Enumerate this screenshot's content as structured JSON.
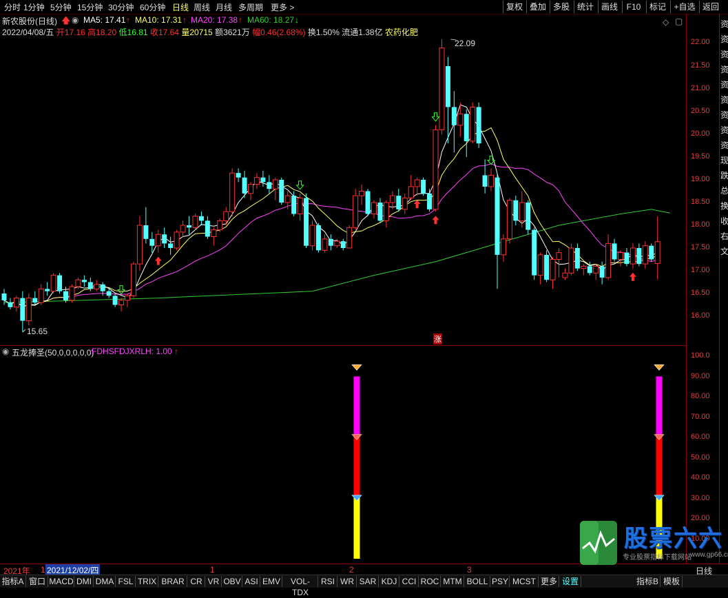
{
  "toolbar": {
    "periods": [
      "分时",
      "1分钟",
      "5分钟",
      "15分钟",
      "30分钟",
      "60分钟",
      "日线",
      "周线",
      "月线",
      "多周期",
      "更多 >"
    ],
    "active_period": "日线",
    "right_buttons": [
      "复权",
      "叠加",
      "多股",
      "统计",
      "画线",
      "F10",
      "标记",
      "+自选",
      "返回"
    ]
  },
  "header": {
    "stock": "新农股份(日线)",
    "ma5": "MA5: 17.41",
    "ma10": "MA10: 17.31",
    "ma20": "MA20: 17.38",
    "ma60": "MA60: 18.27",
    "date": "2022/04/08/五",
    "open_label": "开",
    "open": "17.16",
    "high_label": "高",
    "high": "18.20",
    "low_label": "低",
    "low": "16.81",
    "close_label": "收",
    "close": "17.64",
    "vol_label": "量",
    "vol": "20715",
    "amt_label": "额",
    "amt": "3621万",
    "chg_label": "幅",
    "chg": "0.46(2.68%)",
    "turnover": "换1.50%",
    "float": "流通1.38亿",
    "sector": "农药化肥"
  },
  "colors": {
    "up": "#ff3030",
    "down": "#54ffff",
    "ma5": "#ffffff",
    "ma10": "#ffff66",
    "ma20": "#ff44ff",
    "ma60": "#33cc33",
    "grid_red": "#8a0000"
  },
  "price_axis": [
    "22.00",
    "21.50",
    "21.00",
    "20.50",
    "20.00",
    "19.50",
    "19.00",
    "18.50",
    "18.00",
    "17.50",
    "17.00",
    "16.50",
    "16.00"
  ],
  "annotations": {
    "high_mark": "22.09",
    "low_mark": "15.65",
    "zhang": "涨"
  },
  "indicator": {
    "name": "五龙捧圣(50,0,0,0,0,0)",
    "value": "FDHSFDJXRLH: 1.00",
    "axis": [
      "100.0",
      "90.00",
      "80.00",
      "70.00",
      "60.00",
      "50.00",
      "40.00",
      "30.00",
      "20.00",
      "10.00"
    ]
  },
  "datebar": {
    "year": "2021年",
    "selected_date": "2021/12/02/四",
    "marks": [
      "1",
      "1",
      "2",
      "3"
    ]
  },
  "tabs": [
    "指标A",
    "窗口",
    "MACD",
    "DMI",
    "DMA",
    "FSL",
    "TRIX",
    "BRAR",
    "CR",
    "VR",
    "OBV",
    "ASI",
    "EMV",
    "VOL-TDX",
    "RSI",
    "WR",
    "SAR",
    "KDJ",
    "CCI",
    "ROC",
    "MTM",
    "BOLL",
    "PSY",
    "MCST",
    "更多",
    "设置"
  ],
  "tabs_right": [
    "指标B",
    "模板"
  ],
  "right_side_period": "日线",
  "side_text": [
    "资",
    "资",
    "资",
    "资",
    "资",
    "资",
    "资",
    "资",
    "资",
    "现",
    "跌",
    "总",
    "换",
    "收",
    "右",
    "文"
  ],
  "watermark": {
    "title": "股票六六",
    "subtitle": "专业股票指标下载网站",
    "url": "www.gp66.cn"
  },
  "chart_data": {
    "type": "candlestick",
    "candles": [
      [
        16.5,
        16.6,
        16.25,
        16.35
      ],
      [
        16.3,
        16.4,
        16.15,
        16.2
      ],
      [
        16.2,
        16.45,
        16.1,
        16.4
      ],
      [
        16.4,
        16.55,
        15.65,
        15.9
      ],
      [
        15.9,
        16.5,
        15.8,
        16.4
      ],
      [
        16.4,
        16.55,
        16.25,
        16.3
      ],
      [
        16.3,
        16.7,
        16.25,
        16.6
      ],
      [
        16.6,
        16.75,
        16.45,
        16.55
      ],
      [
        16.55,
        16.95,
        16.5,
        16.9
      ],
      [
        16.9,
        16.95,
        16.5,
        16.55
      ],
      [
        16.55,
        16.65,
        16.3,
        16.35
      ],
      [
        16.35,
        16.7,
        16.3,
        16.65
      ],
      [
        16.65,
        16.85,
        16.6,
        16.8
      ],
      [
        16.8,
        16.9,
        16.65,
        16.75
      ],
      [
        16.75,
        16.85,
        16.55,
        16.6
      ],
      [
        16.6,
        16.8,
        16.55,
        16.7
      ],
      [
        16.7,
        16.75,
        16.45,
        16.55
      ],
      [
        16.55,
        16.6,
        16.4,
        16.45
      ],
      [
        16.45,
        16.5,
        16.2,
        16.25
      ],
      [
        16.25,
        16.4,
        16.1,
        16.35
      ],
      [
        16.35,
        16.5,
        16.2,
        16.45
      ],
      [
        16.45,
        17.2,
        16.4,
        17.15
      ],
      [
        17.15,
        18.2,
        17.0,
        18.0
      ],
      [
        18.0,
        18.4,
        17.6,
        17.7
      ],
      [
        17.7,
        17.85,
        17.4,
        17.55
      ],
      [
        17.55,
        17.9,
        17.4,
        17.8
      ],
      [
        17.8,
        17.95,
        17.5,
        17.6
      ],
      [
        17.6,
        17.75,
        17.35,
        17.5
      ],
      [
        17.5,
        17.9,
        17.45,
        17.85
      ],
      [
        17.85,
        18.1,
        17.75,
        18.0
      ],
      [
        18.0,
        18.2,
        17.8,
        17.95
      ],
      [
        17.95,
        18.25,
        17.9,
        18.2
      ],
      [
        18.2,
        18.3,
        18.0,
        18.1
      ],
      [
        18.1,
        18.2,
        17.7,
        17.75
      ],
      [
        17.75,
        17.95,
        17.55,
        17.9
      ],
      [
        17.9,
        18.15,
        17.85,
        18.1
      ],
      [
        18.1,
        18.4,
        18.0,
        18.3
      ],
      [
        18.3,
        19.25,
        18.2,
        19.15
      ],
      [
        19.15,
        19.25,
        18.95,
        19.05
      ],
      [
        19.05,
        19.2,
        18.6,
        18.7
      ],
      [
        18.7,
        18.95,
        18.55,
        18.9
      ],
      [
        18.9,
        19.15,
        18.8,
        19.05
      ],
      [
        19.05,
        19.2,
        18.85,
        18.95
      ],
      [
        18.95,
        19.1,
        18.7,
        18.8
      ],
      [
        18.8,
        19.05,
        18.55,
        19.0
      ],
      [
        19.0,
        19.05,
        18.45,
        18.5
      ],
      [
        18.5,
        18.75,
        18.35,
        18.65
      ],
      [
        18.65,
        18.75,
        18.2,
        18.25
      ],
      [
        18.25,
        18.7,
        18.1,
        18.6
      ],
      [
        18.6,
        18.7,
        17.5,
        17.55
      ],
      [
        17.55,
        18.1,
        17.45,
        18.0
      ],
      [
        18.0,
        18.05,
        17.4,
        17.45
      ],
      [
        17.45,
        17.8,
        17.4,
        17.7
      ],
      [
        17.7,
        17.8,
        17.45,
        17.55
      ],
      [
        17.55,
        17.7,
        17.5,
        17.65
      ],
      [
        17.65,
        17.7,
        17.45,
        17.5
      ],
      [
        17.5,
        18.0,
        17.5,
        17.95
      ],
      [
        17.95,
        18.8,
        17.9,
        18.65
      ],
      [
        18.65,
        18.9,
        18.45,
        18.75
      ],
      [
        18.75,
        18.8,
        18.2,
        18.25
      ],
      [
        18.25,
        18.55,
        18.15,
        18.5
      ],
      [
        18.5,
        18.6,
        18.05,
        18.1
      ],
      [
        18.1,
        18.55,
        17.95,
        18.5
      ],
      [
        18.5,
        18.75,
        18.35,
        18.65
      ],
      [
        18.65,
        18.8,
        18.3,
        18.35
      ],
      [
        18.35,
        18.7,
        18.25,
        18.6
      ],
      [
        18.6,
        19.1,
        18.55,
        18.85
      ],
      [
        18.85,
        19.05,
        18.65,
        19.0
      ],
      [
        19.0,
        19.05,
        18.65,
        18.7
      ],
      [
        18.7,
        18.8,
        18.3,
        18.35
      ],
      [
        18.35,
        20.2,
        18.3,
        20.1
      ],
      [
        20.1,
        22.09,
        20.0,
        21.9
      ],
      [
        21.5,
        21.7,
        19.8,
        20.6
      ],
      [
        20.6,
        20.95,
        19.6,
        20.2
      ],
      [
        20.2,
        20.7,
        19.95,
        20.45
      ],
      [
        20.45,
        20.55,
        19.5,
        19.85
      ],
      [
        19.85,
        20.7,
        19.8,
        20.6
      ],
      [
        20.6,
        20.7,
        19.7,
        19.8
      ],
      [
        19.1,
        19.45,
        18.7,
        18.85
      ],
      [
        18.85,
        19.25,
        18.75,
        19.1
      ],
      [
        19.05,
        19.15,
        16.6,
        17.35
      ],
      [
        17.35,
        17.8,
        17.2,
        17.7
      ],
      [
        17.7,
        18.6,
        17.6,
        18.55
      ],
      [
        18.55,
        18.65,
        18.0,
        18.1
      ],
      [
        18.1,
        18.75,
        17.95,
        18.5
      ],
      [
        18.5,
        18.55,
        17.8,
        17.9
      ],
      [
        17.9,
        17.95,
        16.8,
        16.9
      ],
      [
        16.9,
        17.4,
        16.7,
        17.35
      ],
      [
        17.35,
        17.45,
        16.75,
        16.8
      ],
      [
        16.8,
        17.3,
        16.6,
        17.25
      ],
      [
        17.25,
        17.5,
        16.85,
        17.4
      ],
      [
        16.85,
        17.05,
        16.8,
        16.95
      ],
      [
        16.95,
        17.6,
        16.9,
        17.5
      ],
      [
        17.5,
        17.6,
        17.0,
        17.05
      ],
      [
        17.05,
        17.15,
        16.9,
        17.1
      ],
      [
        17.1,
        17.2,
        16.9,
        16.95
      ],
      [
        16.95,
        17.15,
        16.8,
        17.1
      ],
      [
        17.1,
        17.2,
        16.7,
        16.85
      ],
      [
        16.85,
        17.8,
        16.8,
        17.6
      ],
      [
        17.6,
        17.7,
        17.2,
        17.25
      ],
      [
        17.25,
        17.45,
        17.1,
        17.4
      ],
      [
        17.4,
        17.5,
        17.1,
        17.15
      ],
      [
        17.15,
        17.6,
        17.05,
        17.5
      ],
      [
        17.5,
        17.6,
        17.1,
        17.15
      ],
      [
        17.15,
        17.65,
        17.05,
        17.55
      ],
      [
        17.55,
        17.6,
        17.2,
        17.25
      ],
      [
        17.16,
        18.2,
        16.81,
        17.64
      ]
    ],
    "ma60_points": [
      [
        16.3,
        0
      ],
      [
        16.4,
        25
      ],
      [
        16.55,
        50
      ],
      [
        16.9,
        60
      ],
      [
        17.2,
        70
      ],
      [
        17.6,
        80
      ],
      [
        18.0,
        90
      ],
      [
        18.25,
        100
      ],
      [
        18.35,
        105
      ],
      [
        18.27,
        108
      ]
    ],
    "indicator_bars": [
      {
        "index": 71,
        "segments": [
          [
            0,
            30,
            "yellow"
          ],
          [
            30,
            60,
            "red"
          ],
          [
            60,
            90,
            "magenta"
          ]
        ],
        "markers": [
          30,
          60,
          90
        ]
      },
      {
        "index": 108,
        "segments": [
          [
            0,
            30,
            "yellow"
          ],
          [
            30,
            60,
            "red"
          ],
          [
            60,
            90,
            "magenta"
          ]
        ],
        "markers": [
          30,
          60,
          90
        ]
      }
    ]
  }
}
